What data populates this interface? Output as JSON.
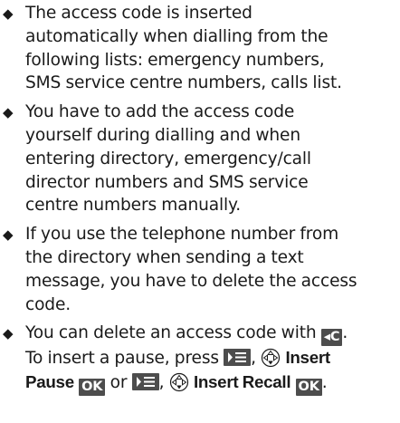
{
  "bullets": [
    {
      "lines": [
        "The access code is inserted",
        "automatically when dialling from the",
        "following lists: emergency numbers,",
        "SMS service centre numbers, calls list."
      ]
    },
    {
      "lines": [
        "You have to add the access code",
        "yourself during dialling and when",
        "entering directory, emergency/call",
        "director numbers and SMS service",
        "centre numbers manually."
      ]
    },
    {
      "lines": [
        "If you use the telephone number from",
        "the directory when sending a text",
        "message, you have to delete the access",
        "code."
      ]
    },
    {
      "line1_text": "You can delete an access code with",
      "line2_prefix": "To insert a pause, press",
      "menu_item_1_part1": "Insert",
      "menu_item_1_part2": "Pause",
      "or_text": "or",
      "menu_item_2": "Insert Recall"
    }
  ],
  "keys": {
    "clear_key": "◂C",
    "ok_key": "OK"
  },
  "icons": {
    "bullet": "diamond-bullet-icon",
    "menu": "menu-key-icon",
    "navigation": "control-key-icon"
  },
  "colors": {
    "key_background": "#4d4d4d",
    "text": "#1a1a1a"
  }
}
